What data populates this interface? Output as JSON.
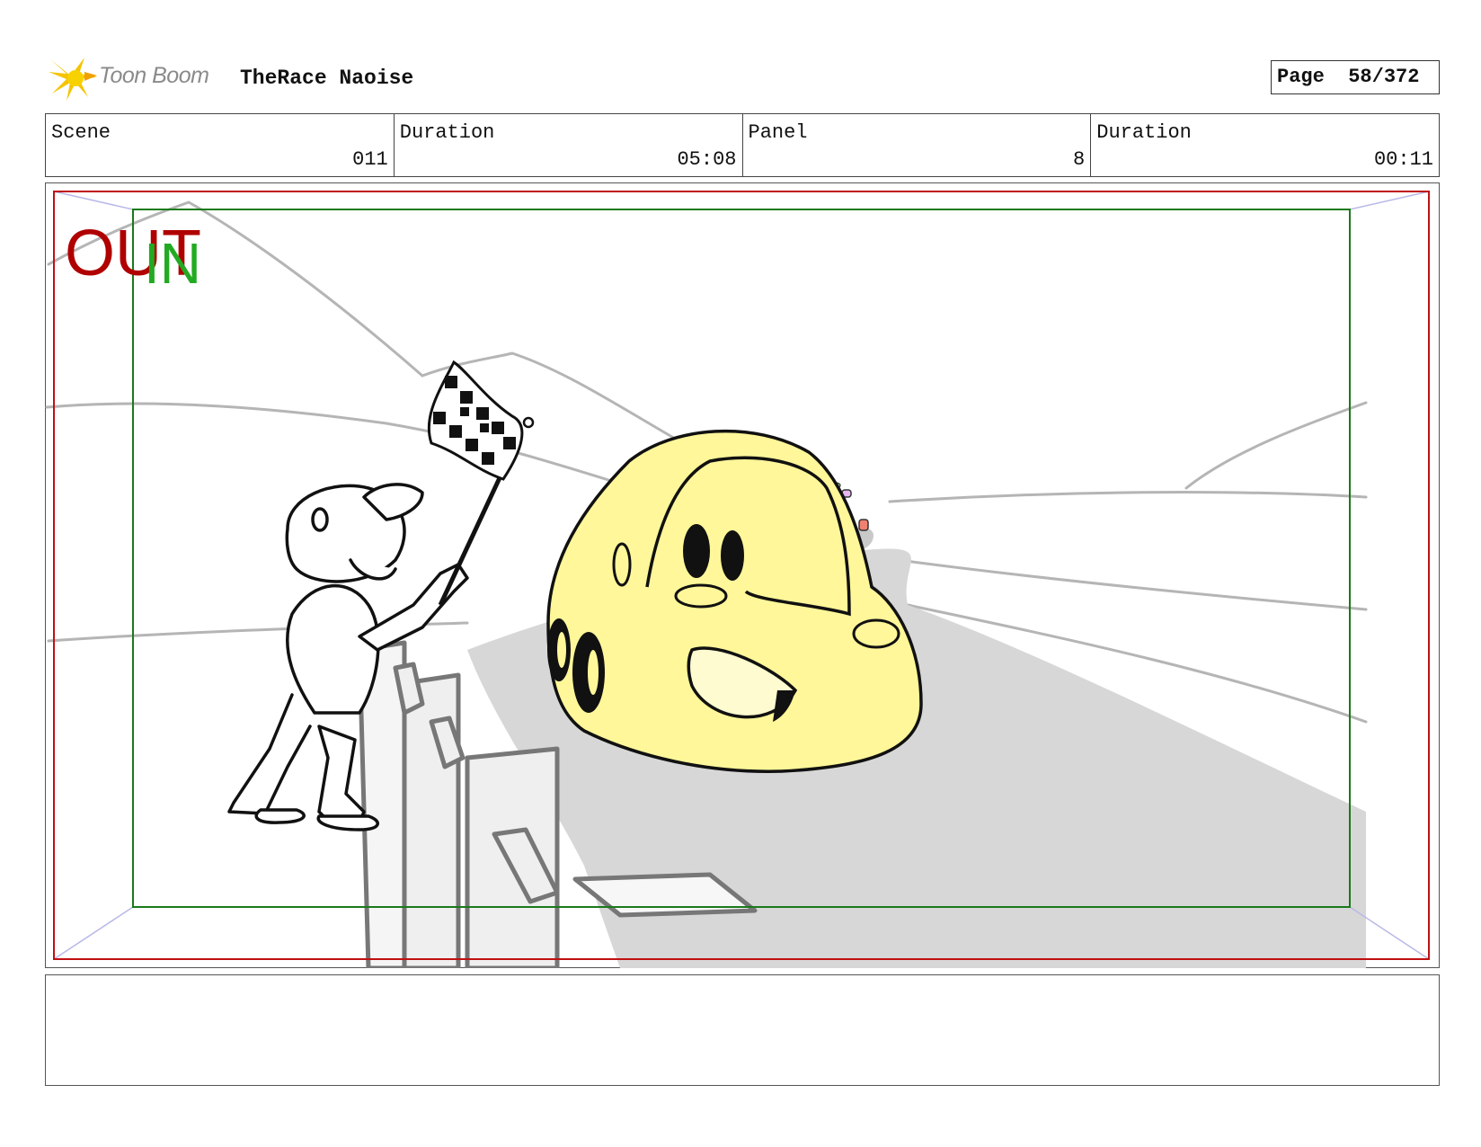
{
  "header": {
    "brand": "Toon Boom",
    "project_title": "TheRace Naoise",
    "page_label": "Page",
    "page_value": "58/372"
  },
  "info": {
    "scene_label": "Scene",
    "scene_value": "011",
    "duration_label": "Duration",
    "duration_value": "05:08",
    "panel_label": "Panel",
    "panel_value": "8",
    "panel_duration_label": "Duration",
    "panel_duration_value": "00:11"
  },
  "panel": {
    "out_label": "OUT",
    "in_label": "IN",
    "out_color": "#b00000",
    "in_color": "#22aa22",
    "car_color": "#fff799",
    "road_color": "#d7d7d7"
  },
  "caption": {
    "text": ""
  }
}
